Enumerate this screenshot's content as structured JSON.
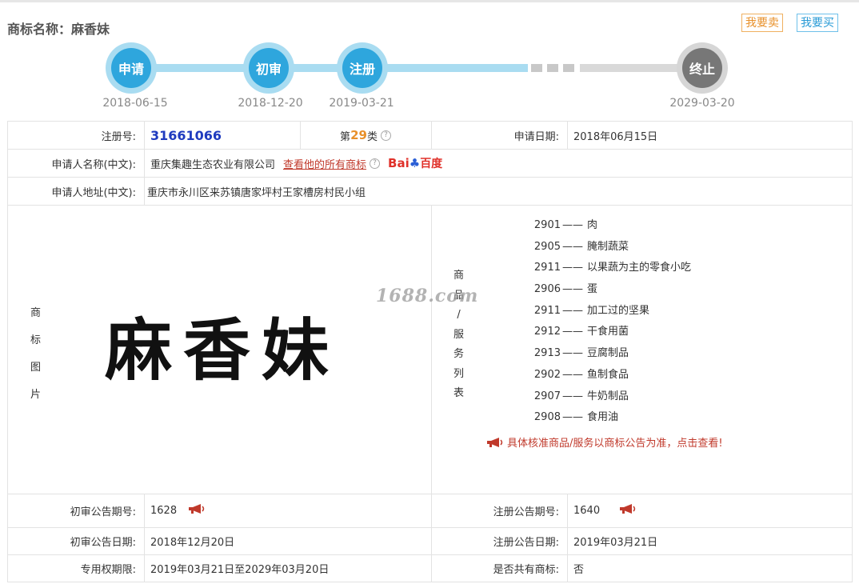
{
  "header": {
    "title": "商标名称：麻香妹",
    "sell_label": "我要卖",
    "buy_label": "我要买"
  },
  "progress": {
    "steps": [
      {
        "label": "申请",
        "date": "2018-06-15"
      },
      {
        "label": "初审",
        "date": "2018-12-20"
      },
      {
        "label": "注册",
        "date": "2019-03-21"
      },
      {
        "label": "终止",
        "date": "2029-03-20"
      }
    ]
  },
  "info": {
    "reg_no_label": "注册号:",
    "reg_no": "31661066",
    "class_prefix": "第",
    "class_num": "29",
    "class_suffix": "类",
    "apply_date_label": "申请日期:",
    "apply_date": "2018年06月15日",
    "applicant_label": "申请人名称(中文):",
    "applicant": "重庆集趣生态农业有限公司",
    "all_marks_link": "查看他的所有商标",
    "baidu_text_a": "Bai",
    "baidu_text_b": "百度",
    "address_label": "申请人地址(中文):",
    "address": "重庆市永川区来苏镇唐家坪村王家槽房村民小组",
    "image_label": [
      "商",
      "标",
      "图",
      "片"
    ],
    "logo_text": "麻香妹",
    "goods_label": [
      "商",
      "品",
      "/",
      "服",
      "务",
      "列",
      "表"
    ],
    "goods": [
      {
        "code": "2901",
        "name": "肉"
      },
      {
        "code": "2905",
        "name": "腌制蔬菜"
      },
      {
        "code": "2911",
        "name": "以果蔬为主的零食小吃"
      },
      {
        "code": "2906",
        "name": "蛋"
      },
      {
        "code": "2911",
        "name": "加工过的坚果"
      },
      {
        "code": "2912",
        "name": "干食用菌"
      },
      {
        "code": "2913",
        "name": "豆腐制品"
      },
      {
        "code": "2902",
        "name": "鱼制食品"
      },
      {
        "code": "2907",
        "name": "牛奶制品"
      },
      {
        "code": "2908",
        "name": "食用油"
      }
    ],
    "goods_dash": "——",
    "goods_notice": "具体核准商品/服务以商标公告为准，点击查看!",
    "watermark": "1688.com",
    "prelim_no_label": "初审公告期号:",
    "prelim_no": "1628",
    "reg_pub_no_label": "注册公告期号:",
    "reg_pub_no": "1640",
    "prelim_date_label": "初审公告日期:",
    "prelim_date": "2018年12月20日",
    "reg_pub_date_label": "注册公告日期:",
    "reg_pub_date": "2019年03月21日",
    "term_label": "专用权期限:",
    "term": "2019年03月21日至2029年03月20日",
    "shared_label": "是否共有商标:",
    "shared": "否"
  },
  "colors": {
    "accent_blue": "#2ea6dd",
    "accent_orange": "#e8902a",
    "link_red": "#c0392b"
  }
}
